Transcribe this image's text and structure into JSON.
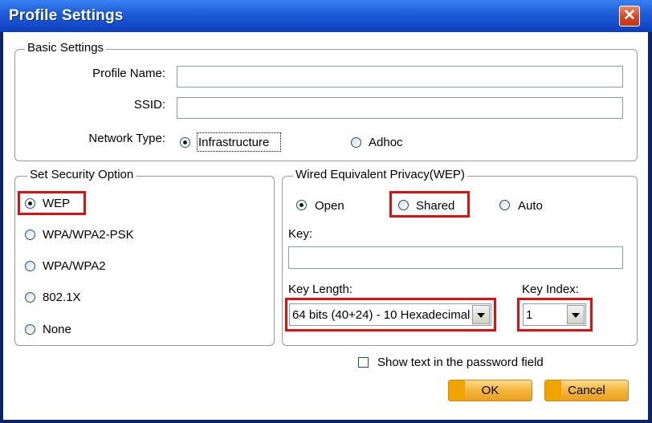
{
  "window": {
    "title": "Profile Settings"
  },
  "basic_settings": {
    "legend": "Basic Settings",
    "profile_name_label": "Profile Name:",
    "profile_name_value": "",
    "ssid_label": "SSID:",
    "ssid_value": "",
    "network_type_label": "Network Type:",
    "options": [
      {
        "label": "Infrastructure",
        "selected": true
      },
      {
        "label": "Adhoc",
        "selected": false
      }
    ]
  },
  "security": {
    "legend": "Set Security Option",
    "options": [
      {
        "label": "WEP",
        "selected": true
      },
      {
        "label": "WPA/WPA2-PSK",
        "selected": false
      },
      {
        "label": "WPA/WPA2",
        "selected": false
      },
      {
        "label": "802.1X",
        "selected": false
      },
      {
        "label": "None",
        "selected": false
      }
    ]
  },
  "wep": {
    "legend": "Wired Equivalent Privacy(WEP)",
    "auth_options": [
      {
        "label": "Open",
        "selected": true
      },
      {
        "label": "Shared",
        "selected": false
      },
      {
        "label": "Auto",
        "selected": false
      }
    ],
    "key_label": "Key:",
    "key_value": "",
    "key_length_label": "Key Length:",
    "key_length_value": "64 bits (40+24) - 10 Hexadecimal",
    "key_index_label": "Key Index:",
    "key_index_value": "1"
  },
  "footer": {
    "show_text_label": "Show text in the password field",
    "show_text_checked": false,
    "ok_label": "OK",
    "cancel_label": "Cancel"
  },
  "colors": {
    "highlight_red": "#e01010",
    "title_blue": "#1f5fd8",
    "button_orange": "#f3b53c"
  }
}
